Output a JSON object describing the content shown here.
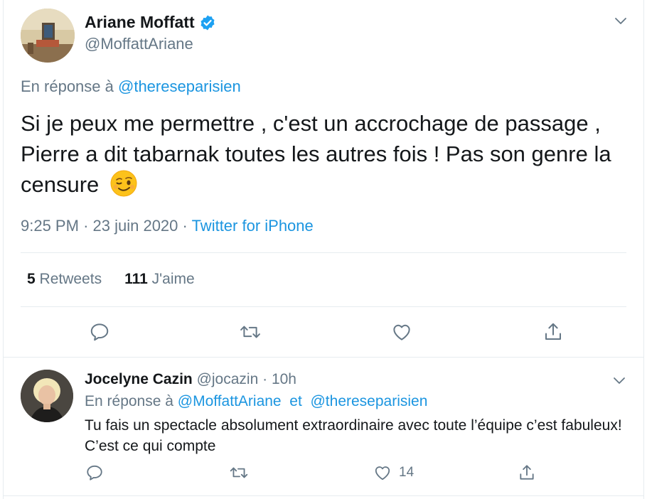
{
  "main_tweet": {
    "author_name": "Ariane Moffatt",
    "author_handle": "@MoffattAriane",
    "verified_icon": "verified-badge-icon",
    "reply_prefix": "En réponse à",
    "reply_to": "@thereseparisien",
    "text": "Si je peux me permettre , c'est un accrochage de passage , Pierre a dit tabarnak toutes les autres fois ! Pas son genre la censure",
    "emoji": "winking-face",
    "time": "9:25 PM",
    "date": "23 juin 2020",
    "dot": "·",
    "source": "Twitter for iPhone",
    "retweets_count": "5",
    "retweets_label": "Retweets",
    "likes_count": "111",
    "likes_label": "J'aime"
  },
  "reply_tweet": {
    "author_name": "Jocelyne Cazin",
    "author_handle": "@jocazin",
    "dot": "·",
    "time_ago": "10h",
    "reply_prefix": "En réponse à",
    "reply_to_1": "@MoffattAriane",
    "and": "et",
    "reply_to_2": "@thereseparisien",
    "text": "Tu fais un spectacle absolument extraordinaire avec toute l’équipe c’est fabuleux! C’est ce qui compte",
    "likes_count": "14"
  },
  "colors": {
    "link": "#1b95e0",
    "secondary_text": "#657786",
    "primary_text": "#14171a",
    "divider": "#e6ecf0"
  }
}
